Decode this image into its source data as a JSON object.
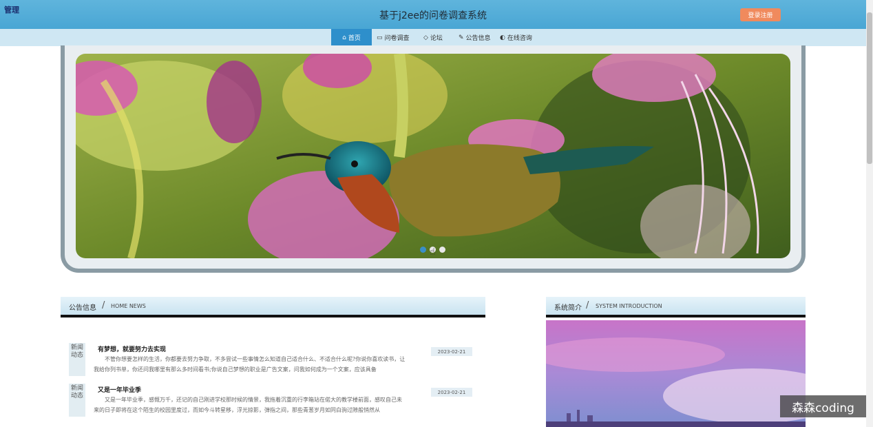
{
  "header": {
    "corner_label": "管理",
    "title": "基于j2ee的问卷调查系统",
    "login_label": "登录注册",
    "accent": "#49a6d4"
  },
  "nav": {
    "items": [
      {
        "label": "首页",
        "icon": "home-icon",
        "active": true
      },
      {
        "label": "问卷调查",
        "icon": "survey-icon",
        "active": false
      },
      {
        "label": "论坛",
        "icon": "forum-icon",
        "active": false
      },
      {
        "label": "公告信息",
        "icon": "notice-icon",
        "active": false
      },
      {
        "label": "在线咨询",
        "icon": "chat-icon",
        "active": false
      }
    ]
  },
  "banner": {
    "slides_total": 3,
    "active_slide": 1
  },
  "news": {
    "title_cn": "公告信息",
    "slash": "/",
    "title_en": "HOME NEWS",
    "items": [
      {
        "badge": "新闻动态",
        "title": "有梦想，就要努力去实现",
        "body": "不管你想要怎样的生活，你都要去努力争取，不多尝试一些事情怎么知道自己适合什么、不适合什么呢?你说你喜欢读书，让我给你列书单，你还问我哪里有那么多时间看书;你说自己梦想的职业是广告文案，问我如何成为一个文案，应该具备",
        "date": "2023-02-21"
      },
      {
        "badge": "新闻动态",
        "title": "又是一年毕业季",
        "body": "又是一年毕业季，感慨万千，还记的自己刚进学校那时候的情景，我拖着沉重的行李箱站在偌大的教学楼前面，感叹自己未来的日子即将在这个陌生的校园里度过，而如今斗转星移，浮光掠影，弹指之间，那些青葱岁月如同白驹过隙般悄然从",
        "date": "2023-02-21"
      }
    ]
  },
  "intro": {
    "title_cn": "系统简介",
    "slash": "/",
    "title_en": "SYSTEM INTRODUCTION"
  },
  "watermark": "森森coding"
}
